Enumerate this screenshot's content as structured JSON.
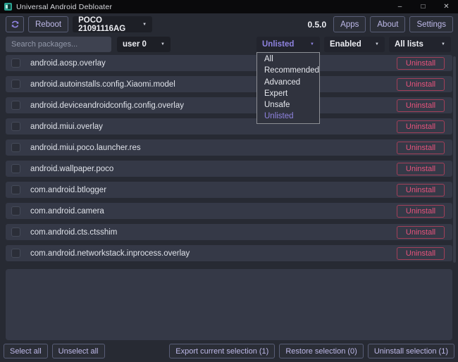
{
  "titlebar": {
    "title": "Universal Android Debloater",
    "minimize_glyph": "–",
    "maximize_glyph": "□",
    "close_glyph": "✕"
  },
  "toolbar": {
    "reboot_label": "Reboot",
    "device_selector_value": "POCO 21091116AG",
    "version": "0.5.0",
    "apps_label": "Apps",
    "about_label": "About",
    "settings_label": "Settings"
  },
  "filters": {
    "search_placeholder": "Search packages...",
    "user_select_value": "user 0",
    "debloat_select_value": "Unlisted",
    "state_select_value": "Enabled",
    "lists_select_value": "All lists"
  },
  "debloat_menu": {
    "options": [
      {
        "label": "All",
        "selected": false
      },
      {
        "label": "Recommended",
        "selected": false
      },
      {
        "label": "Advanced",
        "selected": false
      },
      {
        "label": "Expert",
        "selected": false
      },
      {
        "label": "Unsafe",
        "selected": false
      },
      {
        "label": "Unlisted",
        "selected": true
      }
    ]
  },
  "packages": [
    {
      "name": "android.aosp.overlay",
      "action_label": "Uninstall"
    },
    {
      "name": "android.autoinstalls.config.Xiaomi.model",
      "action_label": "Uninstall"
    },
    {
      "name": "android.deviceandroidconfig.config.overlay",
      "action_label": "Uninstall"
    },
    {
      "name": "android.miui.overlay",
      "action_label": "Uninstall"
    },
    {
      "name": "android.miui.poco.launcher.res",
      "action_label": "Uninstall"
    },
    {
      "name": "android.wallpaper.poco",
      "action_label": "Uninstall"
    },
    {
      "name": "com.android.btlogger",
      "action_label": "Uninstall"
    },
    {
      "name": "com.android.camera",
      "action_label": "Uninstall"
    },
    {
      "name": "com.android.cts.ctsshim",
      "action_label": "Uninstall"
    },
    {
      "name": "com.android.networkstack.inprocess.overlay",
      "action_label": "Uninstall"
    }
  ],
  "footer": {
    "select_all_label": "Select all",
    "unselect_all_label": "Unselect all",
    "export_label": "Export current selection (1)",
    "restore_label": "Restore selection (0)",
    "uninstall_label": "Uninstall selection (1)"
  },
  "icons": {
    "caret": "▼"
  },
  "colors": {
    "accent_purple": "#8f83e0",
    "danger_pink": "#e8537c",
    "row_background": "#353947",
    "window_background": "#272a33",
    "titlebar_background": "#0a0a0c"
  }
}
